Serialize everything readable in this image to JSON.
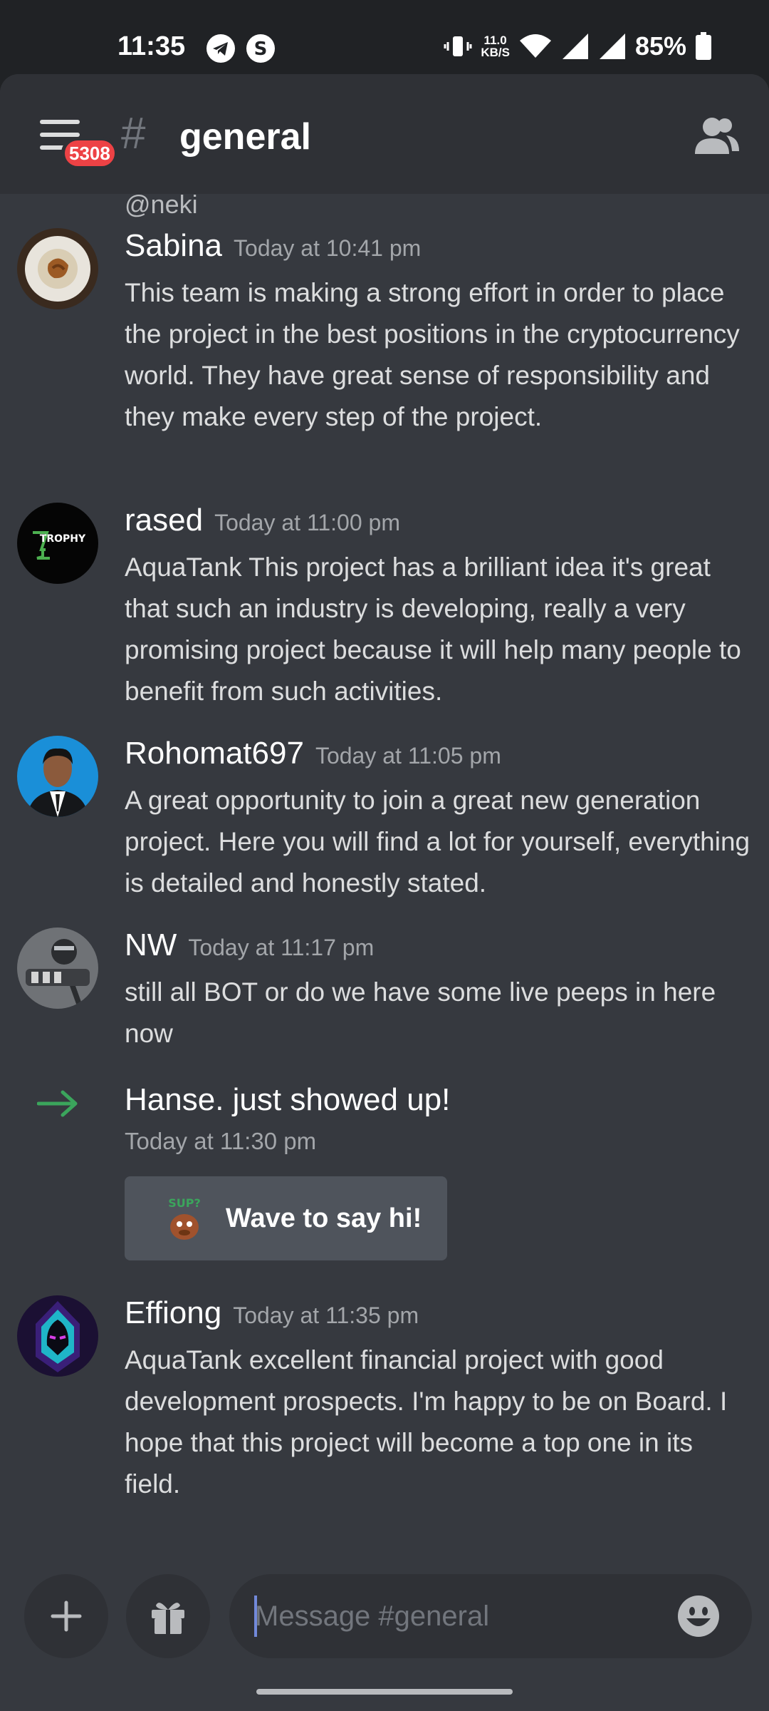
{
  "status_bar": {
    "time": "11:35",
    "net_speed_value": "11.0",
    "net_speed_unit": "KB/S",
    "battery": "85%",
    "icons": [
      "telegram-icon",
      "shazam-icon",
      "vibrate-icon",
      "wifi-icon",
      "signal-icon",
      "signal-icon",
      "battery-icon"
    ]
  },
  "header": {
    "menu_badge": "5308",
    "hash": "#",
    "channel_name": "general"
  },
  "previous_message_tail": "@neki",
  "messages": [
    {
      "author": "Sabina",
      "timestamp": "Today at 10:41 pm",
      "text": "This team is making a strong effort in order to place the project in the best positions in the cryptocurrency world. They have great sense of responsibility and they make every step of the project."
    },
    {
      "author": "rased",
      "timestamp": "Today at 11:00 pm",
      "avatar_text": "TROPHY",
      "text": "AquaTank This project has a brilliant idea it's great that such an industry is developing, really a very promising project because it will help many people to benefit from such activities."
    },
    {
      "author": "Rohomat697",
      "timestamp": "Today at 11:05 pm",
      "text": "A great opportunity to join a great new generation project. Here you will find a lot for yourself, everything is detailed and honestly stated."
    },
    {
      "author": "NW",
      "timestamp": "Today at 11:17 pm",
      "text": "still all BOT or do we have some live peeps in here now"
    }
  ],
  "join_event": {
    "text": "Hanse. just showed up!",
    "timestamp": "Today at 11:30 pm",
    "wave_button_label": "Wave to say hi!",
    "sticker_text": "SUP?"
  },
  "last_message": {
    "author": "Effiong",
    "timestamp": "Today at 11:35 pm",
    "text": "AquaTank excellent financial project with good development prospects. I'm happy to be on Board. I hope that this project will become a top one in its field."
  },
  "composer": {
    "placeholder": "Message #general"
  },
  "colors": {
    "background": "#36393f",
    "header": "#2f3136",
    "badge": "#ed4245",
    "join_arrow": "#3ba55c",
    "caret": "#7289da"
  }
}
